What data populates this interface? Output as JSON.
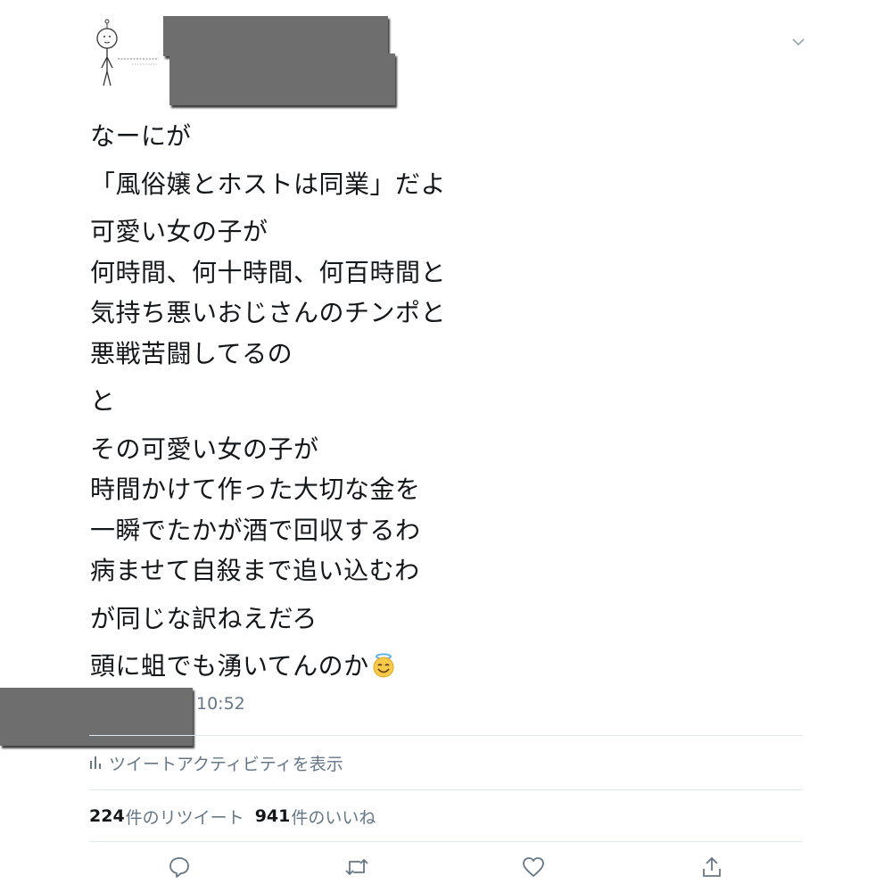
{
  "tweet": {
    "lines_para1": [
      "なーにが"
    ],
    "lines_para2": [
      "「風俗嬢とホストは同業」だよ"
    ],
    "lines_para3": [
      "可愛い女の子が",
      "何時間、何十時間、何百時間と",
      "気持ち悪いおじさんのチンポと",
      "悪戦苦闘してるの"
    ],
    "lines_para4": [
      "と"
    ],
    "lines_para5": [
      "その可愛い女の子が",
      "時間かけて作った大切な金を",
      "一瞬でたかが酒で回収するわ",
      "病ませて自殺まで追い込むわ"
    ],
    "lines_para6": [
      "が同じな訳ねえだろ"
    ],
    "lines_para7": [
      "頭に蛆でも湧いてんのか"
    ],
    "emoji": "smiling-face-with-halo",
    "time": "10:52"
  },
  "activity": {
    "label": "ツイートアクティビティを表示"
  },
  "stats": {
    "retweets_count": "224",
    "retweets_label": "件のリツイート",
    "likes_count": "941",
    "likes_label": "件のいいね"
  },
  "actions": [
    "reply",
    "retweet",
    "like",
    "share"
  ],
  "colors": {
    "text": "#14171a",
    "secondary": "#657786",
    "divider": "#e1e8ed",
    "redaction": "#6e6e6e"
  }
}
